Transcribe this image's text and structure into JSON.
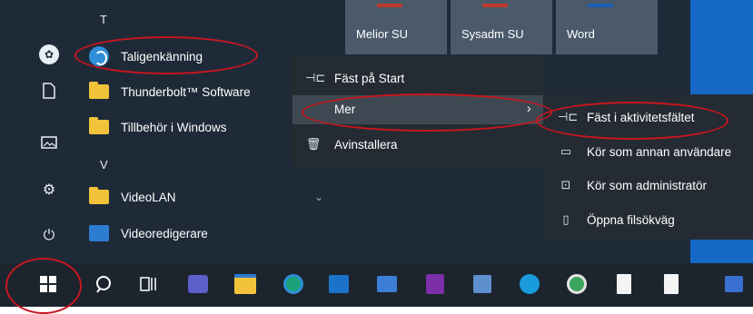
{
  "start_menu": {
    "rail": {
      "items": [
        {
          "icon": "profile-logo-icon"
        },
        {
          "icon": "document-icon"
        },
        {
          "icon": "pictures-icon"
        },
        {
          "icon": "settings-gear-icon"
        },
        {
          "icon": "power-icon"
        }
      ]
    },
    "app_list": {
      "section_t": "T",
      "section_v": "V",
      "apps": [
        {
          "label": "Taligenkänning",
          "icon": "speech-recognition-icon"
        },
        {
          "label": "Thunderbolt™ Software",
          "icon": "folder-icon"
        },
        {
          "label": "Tillbehör i Windows",
          "icon": "folder-icon"
        },
        {
          "label": "VideoLAN",
          "icon": "folder-icon"
        },
        {
          "label": "Videoredigerare",
          "icon": "video-editor-icon"
        }
      ]
    },
    "tiles": [
      "Melior SU",
      "Sysadm SU",
      "Word"
    ]
  },
  "context_menu": {
    "items": [
      {
        "label": "Fäst på Start",
        "icon": "pin-icon"
      },
      {
        "label": "Mer",
        "icon": ""
      },
      {
        "label": "Avinstallera",
        "icon": "trash-icon"
      }
    ],
    "submenu_chevron": "›"
  },
  "submenu": {
    "items": [
      {
        "label": "Fäst i aktivitetsfältet",
        "icon": "pin-icon"
      },
      {
        "label": "Kör som annan användare",
        "icon": "run-as-user-icon"
      },
      {
        "label": "Kör som administratör",
        "icon": "run-as-admin-icon"
      },
      {
        "label": "Öppna filsökväg",
        "icon": "open-file-location-icon"
      }
    ]
  },
  "taskbar": {
    "icons": [
      "start-windows-icon",
      "search-icon",
      "task-view-icon",
      "teams-icon",
      "file-explorer-icon",
      "edge-icon",
      "outlook-icon",
      "remote-desktop-icon",
      "onenote-icon",
      "app-icon",
      "skype-icon",
      "browser-icon",
      "file-icon",
      "file-icon",
      "app-icon"
    ]
  },
  "colors": {
    "menu_bg": "#1f2a38",
    "context_bg": "#242b33",
    "highlight": "#3e4852",
    "annotation": "#c8161e",
    "tile_blue": "#1668c7",
    "taskbar_bg": "#1c242e"
  }
}
